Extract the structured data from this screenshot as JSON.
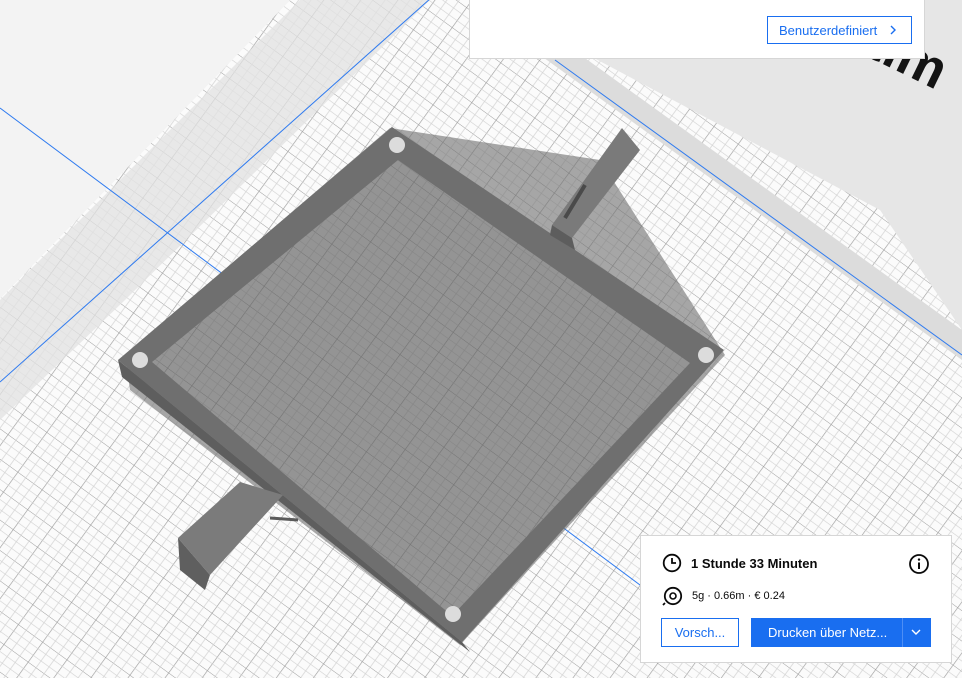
{
  "settings": {
    "custom_label": "Benutzerdefiniert"
  },
  "job": {
    "duration": "1 Stunde 33 Minuten",
    "material": "5g · 0.66m · € 0.24"
  },
  "actions": {
    "preview_label": "Vorsch...",
    "print_label": "Drucken über Netz..."
  },
  "buildplate": {
    "label": "ultim"
  },
  "colors": {
    "accent": "#196ef0",
    "model": "#6f6f6f",
    "grid": "#b8b8b8",
    "plate": "#f8f8f8"
  }
}
